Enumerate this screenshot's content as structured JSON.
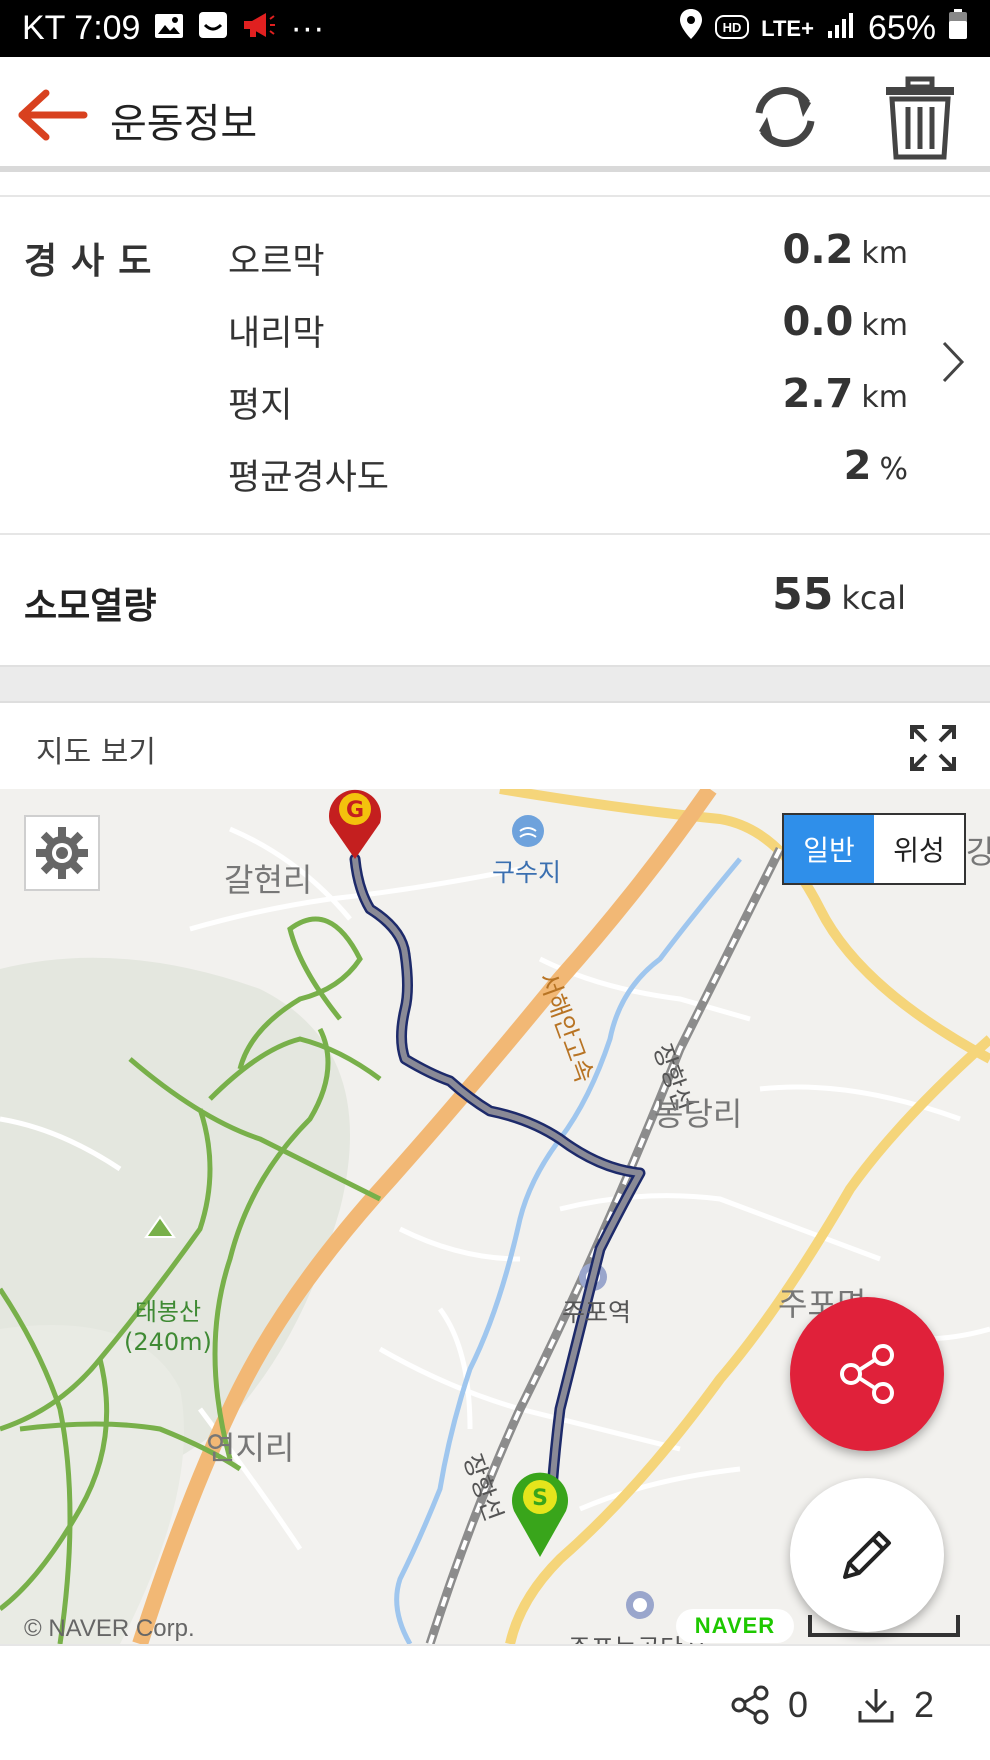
{
  "status_bar": {
    "carrier_time": "KT 7:09",
    "more": "···",
    "network": "LTE+",
    "battery": "65%",
    "icons": [
      "image-icon",
      "face-icon",
      "megaphone-icon",
      "location-icon",
      "hd-icon",
      "signal-icon",
      "battery-icon"
    ]
  },
  "app_bar": {
    "title": "운동정보",
    "accent_color": "#d8411f"
  },
  "slope": {
    "title": "경사도",
    "rows": [
      {
        "label": "오르막",
        "value": "0.2",
        "unit": "km"
      },
      {
        "label": "내리막",
        "value": "0.0",
        "unit": "km"
      },
      {
        "label": "평지",
        "value": "2.7",
        "unit": "km"
      },
      {
        "label": "평균경사도",
        "value": "2",
        "unit": "%"
      }
    ]
  },
  "calories": {
    "label": "소모열량",
    "value": "55",
    "unit": "kcal"
  },
  "map": {
    "header_title": "지도 보기",
    "type_normal": "일반",
    "type_satellite": "위성",
    "credit": "© NAVER Corp.",
    "provider_logo": "NAVER",
    "start_marker": "S",
    "goal_marker": "G",
    "labels": {
      "galhyeon": "갈현리",
      "gusuji": "구수지",
      "highway": "서해안고속",
      "janghang1": "장항선",
      "janghang2": "장항선",
      "bongdang": "봉당리",
      "jupo_station": "주포역",
      "jupo_myeon": "주포면",
      "taebong_name": "태봉산",
      "taebong_height": "(240m)",
      "yeonji": "연지리",
      "jupo_industrial": "주포농공단지",
      "partial_right": "강"
    },
    "route_color": "#8a8a96",
    "route_outline": "#1d2a6a",
    "trail_color": "#78b04a",
    "highway_color": "#f2b875",
    "road_color": "#f5d57a"
  },
  "fab": {
    "share_color": "#e0213a"
  },
  "bottom": {
    "share_count": "0",
    "download_count": "2"
  }
}
